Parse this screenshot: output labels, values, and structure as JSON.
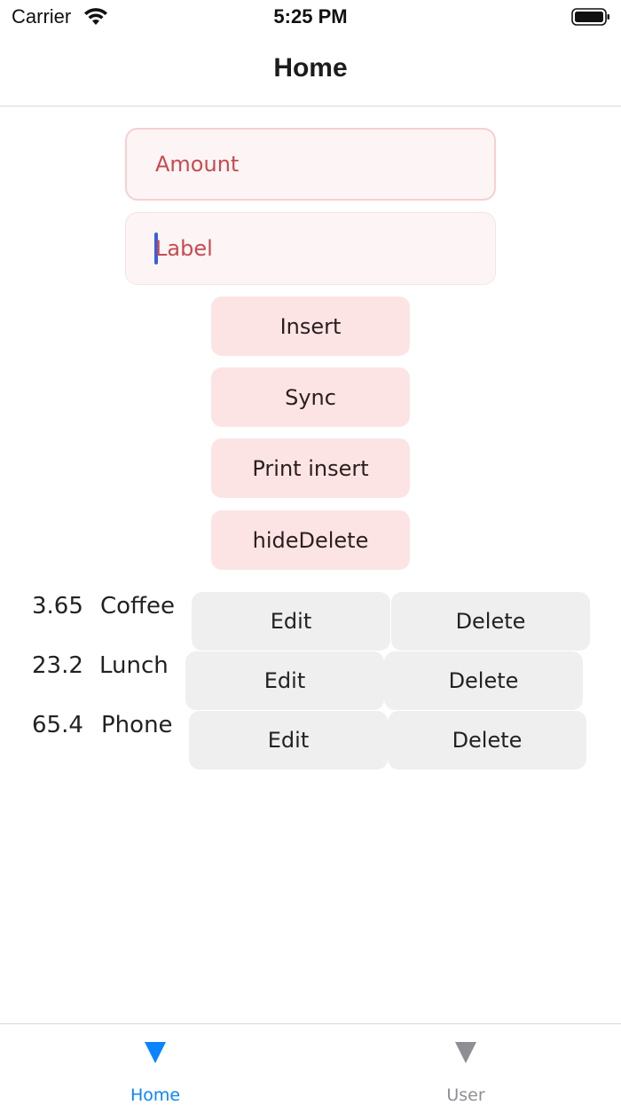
{
  "status_bar": {
    "carrier": "Carrier",
    "time": "5:25 PM"
  },
  "nav": {
    "title": "Home"
  },
  "form": {
    "amount_placeholder": "Amount",
    "label_placeholder": "Label"
  },
  "actions": {
    "insert": "Insert",
    "sync": "Sync",
    "print_insert": "Print insert",
    "hide_delete": "hideDelete"
  },
  "entries": [
    {
      "amount": "3.65",
      "label": "Coffee",
      "edit": "Edit",
      "delete": "Delete"
    },
    {
      "amount": "23.2",
      "label": "Lunch",
      "edit": "Edit",
      "delete": "Delete"
    },
    {
      "amount": "65.4",
      "label": "Phone",
      "edit": "Edit",
      "delete": "Delete"
    }
  ],
  "tabs": [
    {
      "label": "Home",
      "icon": "triangle-down-icon",
      "active": true
    },
    {
      "label": "User",
      "icon": "triangle-down-icon",
      "active": false
    }
  ],
  "colors": {
    "tab_active": "#0a84ff",
    "tab_inactive": "#8e8e93",
    "placeholder": "#c94a4f",
    "action_button_bg": "#fde4e4",
    "row_button_bg": "#efefef"
  }
}
